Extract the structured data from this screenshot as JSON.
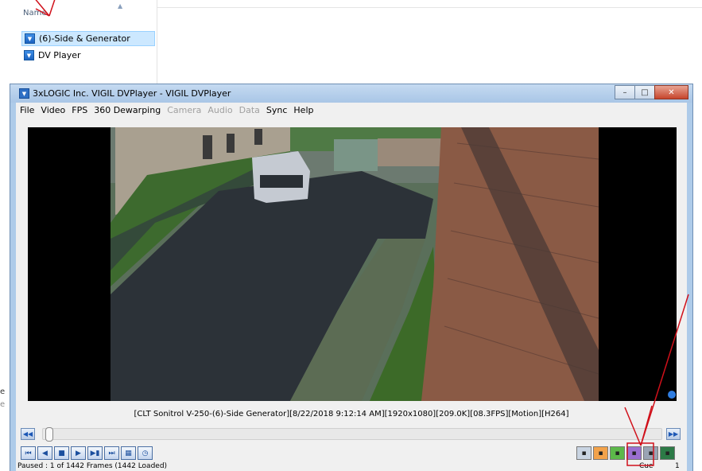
{
  "explorer": {
    "name_header": "Name",
    "files": [
      {
        "label": "(6)-Side & Generator",
        "selected": true
      },
      {
        "label": "DV Player",
        "selected": false
      }
    ],
    "left_cutoff_chars": [
      "e",
      "e"
    ]
  },
  "window": {
    "title": "3xLOGIC Inc. VIGIL DVPlayer - VIGIL DVPlayer",
    "controls": {
      "minimize": "–",
      "maximize": "□",
      "close": "✕"
    }
  },
  "menu": [
    {
      "label": "File",
      "enabled": true
    },
    {
      "label": "Video",
      "enabled": true
    },
    {
      "label": "FPS",
      "enabled": true
    },
    {
      "label": "360 Dewarping",
      "enabled": true
    },
    {
      "label": "Camera",
      "enabled": false
    },
    {
      "label": "Audio",
      "enabled": false
    },
    {
      "label": "Data",
      "enabled": false
    },
    {
      "label": "Sync",
      "enabled": true
    },
    {
      "label": "Help",
      "enabled": true
    }
  ],
  "video": {
    "osd_text": "[CLT Sonitrol V-250-(6)-Side  Generator][8/22/2018 9:12:14 AM][1920x1080][209.0K][08.3FPS][Motion][H264]"
  },
  "playback": {
    "progress_fraction": 0.0,
    "buttons": [
      "skip-to-start",
      "step-back",
      "stop",
      "play",
      "step-forward",
      "skip-to-end",
      "export",
      "clock"
    ],
    "button_glyphs": [
      "⏮",
      "◀",
      "■",
      "▶",
      "▶▮",
      "⏭",
      "▦",
      "◷"
    ]
  },
  "toolbar_right": {
    "buttons": [
      "snapshot",
      "print-frame",
      "export-avi",
      "save",
      "disk",
      "fullscreen"
    ],
    "colors": {
      "snapshot": "#c9d4e2",
      "print-frame": "#f2a24a",
      "export-avi": "#5cb84a",
      "save": "#9a6fd1",
      "disk": "#9aa4b4",
      "fullscreen": "#2c7a46"
    }
  },
  "status": {
    "text": "Paused : 1 of 1442 Frames (1442 Loaded)",
    "cue_label": "Cue",
    "cue_value": "1"
  },
  "annotation_color": "#d0101a"
}
